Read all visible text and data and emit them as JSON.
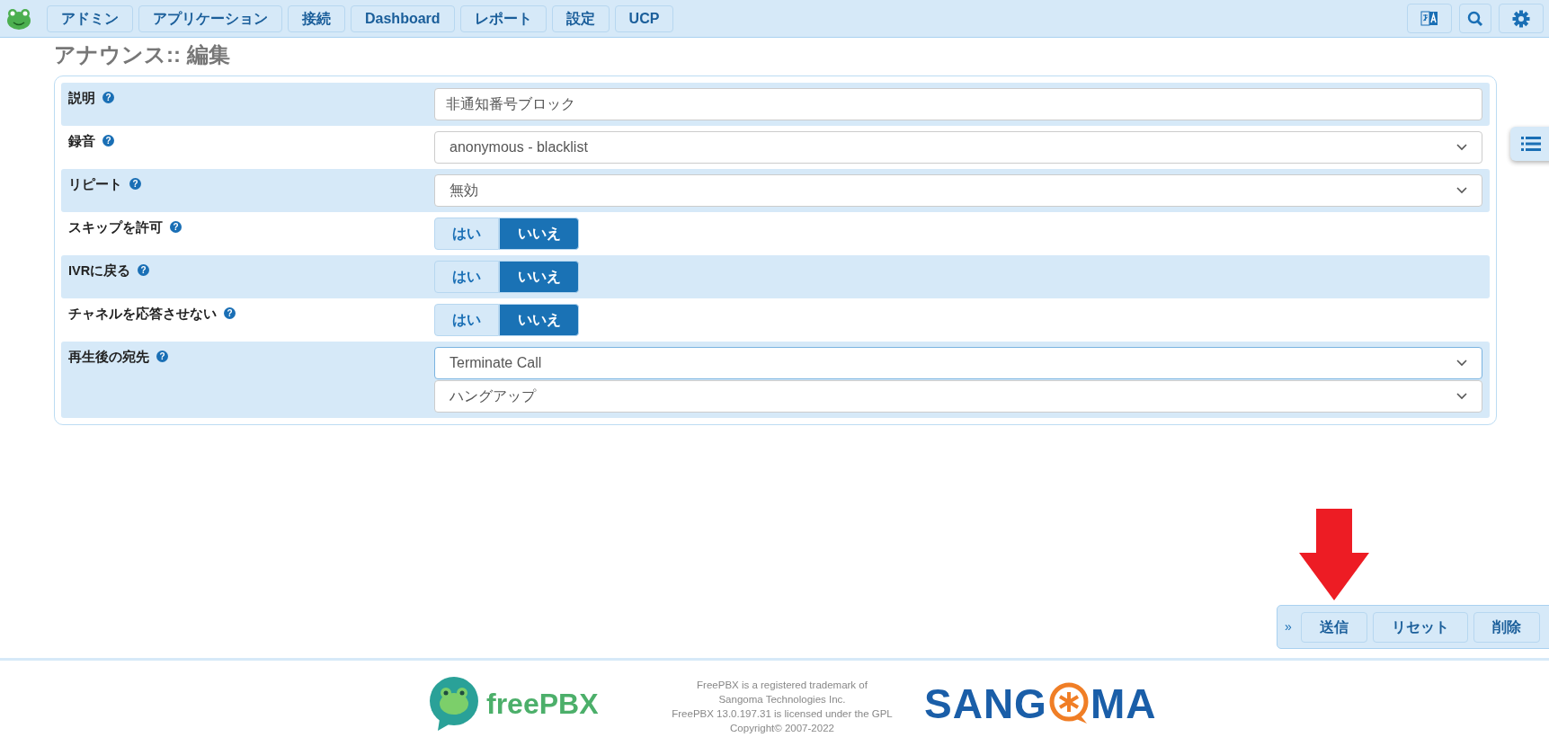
{
  "nav": {
    "items": [
      {
        "label": "アドミン"
      },
      {
        "label": "アプリケーション"
      },
      {
        "label": "接続"
      },
      {
        "label": "Dashboard"
      },
      {
        "label": "レポート"
      },
      {
        "label": "設定"
      },
      {
        "label": "UCP"
      }
    ]
  },
  "page_title": "アナウンス:: 編集",
  "fields": [
    {
      "kind": "text",
      "label": "説明",
      "help": "?",
      "value": "非通知番号ブロック"
    },
    {
      "kind": "select",
      "label": "録音",
      "help": "?",
      "value": "anonymous - blacklist"
    },
    {
      "kind": "select",
      "label": "リピート",
      "help": "?",
      "value": "無効"
    },
    {
      "kind": "toggle",
      "label": "スキップを許可",
      "help": "?",
      "options": [
        {
          "label": "はい",
          "selected": false
        },
        {
          "label": "いいえ",
          "selected": true
        }
      ]
    },
    {
      "kind": "toggle",
      "label": "IVRに戻る",
      "help": "?",
      "options": [
        {
          "label": "はい",
          "selected": false
        },
        {
          "label": "いいえ",
          "selected": true
        }
      ]
    },
    {
      "kind": "toggle",
      "label": "チャネルを応答させない",
      "help": "?",
      "options": [
        {
          "label": "はい",
          "selected": false
        },
        {
          "label": "いいえ",
          "selected": true
        }
      ]
    },
    {
      "kind": "select-pair",
      "label": "再生後の宛先",
      "help": "?",
      "values": [
        "Terminate Call",
        "ハングアップ"
      ]
    }
  ],
  "actions": {
    "expand": "»",
    "buttons": [
      "送信",
      "リセット",
      "削除"
    ]
  },
  "footer": {
    "freepbx": "freePBX",
    "legal": [
      "FreePBX is a registered trademark of",
      "Sangoma Technologies Inc.",
      "FreePBX 13.0.197.31 is licensed under the GPL",
      "Copyright© 2007-2022"
    ],
    "sangoma": {
      "before": "SANG",
      "after": "MA"
    }
  }
}
